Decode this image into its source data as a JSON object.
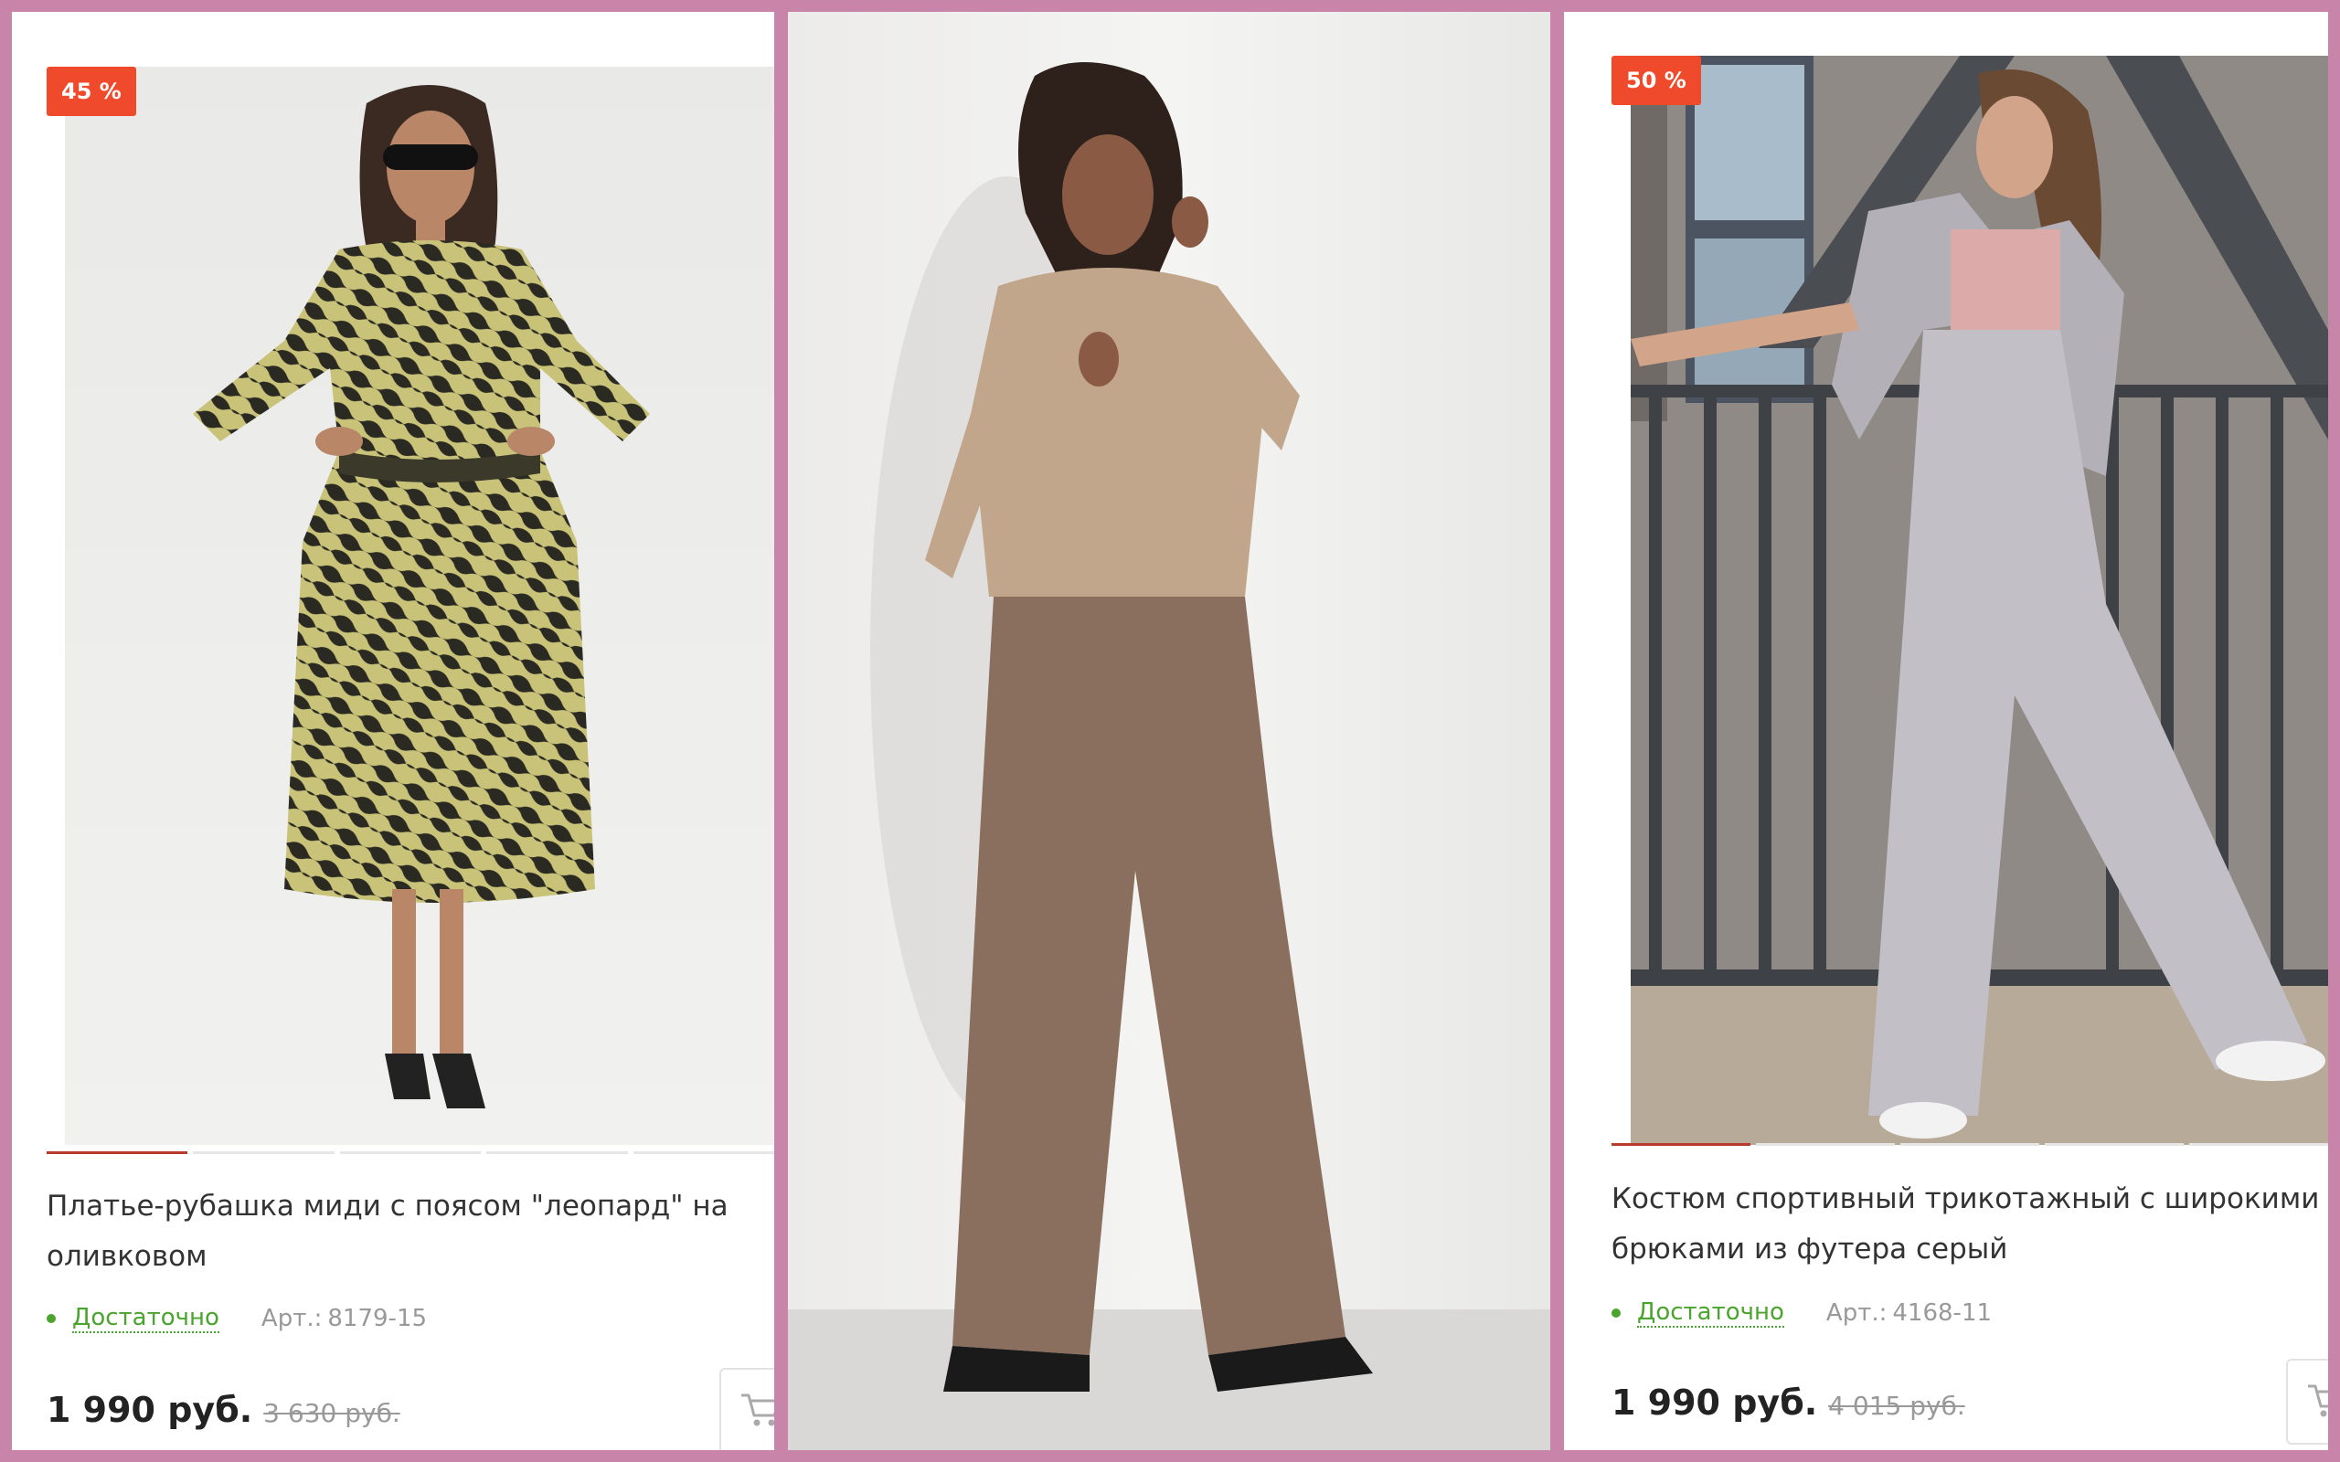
{
  "products": [
    {
      "discount": "45 %",
      "title": "Платье-рубашка миди с поясом \"леопард\" на оливковом",
      "availability": "Достаточно",
      "article_label": "Арт.:",
      "article": "8179-15",
      "price": "1 990 руб.",
      "old_price": "3 630 руб.",
      "image": "Model in zebra-print midi shirt dress with belt and sunglasses",
      "slides": 5,
      "active_slide": 1
    },
    {
      "image": "Model in beige knit half-zip sweater and wide brown pleated trousers"
    },
    {
      "discount": "50 %",
      "title": "Костюм спортивный трикотажный с широкими брюками из футера серый",
      "availability": "Достаточно",
      "article_label": "Арт.:",
      "article": "4168-11",
      "price": "1 990 руб.",
      "old_price": "4 015 руб.",
      "image": "Model in grey tracksuit with wide pants and pink top near railing",
      "slides": 5,
      "active_slide": 1
    }
  ],
  "colors": {
    "frame": "#c984a9",
    "badge": "#ef4a2b",
    "availability": "#4aa42e",
    "active_slide": "#b73a2c"
  },
  "icons": [
    "cart-icon"
  ]
}
